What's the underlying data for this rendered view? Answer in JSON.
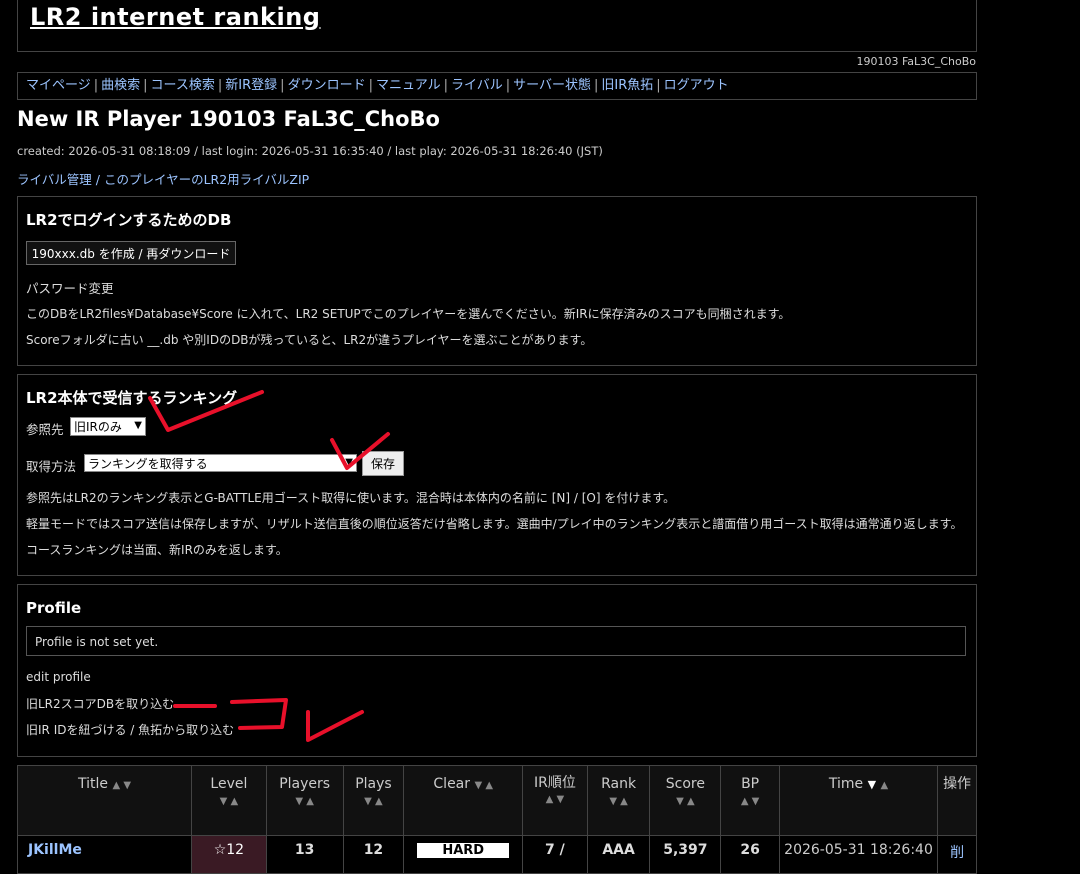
{
  "header": {
    "title": "LR2 internet ranking",
    "user": "190103 FaL3C_ChoBo"
  },
  "nav": {
    "items": [
      "マイページ",
      "曲検索",
      "コース検索",
      "新IR登録",
      "ダウンロード",
      "マニュアル",
      "ライバル",
      "サーバー状態",
      "旧IR魚拓",
      "ログアウト"
    ]
  },
  "player": {
    "title": "New IR Player 190103 FaL3C_ChoBo",
    "meta": "created: 2026-05-31 08:18:09 / last login: 2026-05-31 16:35:40 / last play: 2026-05-31 18:26:40 (JST)",
    "rival_manage": "ライバル管理",
    "rival_sep": " / ",
    "rival_zip": "このプレイヤーのLR2用ライバルZIP"
  },
  "db_box": {
    "title": "LR2でログインするためのDB",
    "button": "190xxx.db を作成 / 再ダウンロード",
    "password_link": "パスワード変更",
    "text1": "このDBをLR2files¥Database¥Score に入れて、LR2 SETUPでこのプレイヤーを選んでください。新IRに保存済みのスコアも同梱されます。",
    "text2": "Scoreフォルダに古い __.db や別IDのDBが残っていると、LR2が違うプレイヤーを選ぶことがあります。"
  },
  "ranking_box": {
    "title": "LR2本体で受信するランキング",
    "ref_label": "参照先",
    "ref_value": "旧IRのみ",
    "method_label": "取得方法",
    "method_value": "ランキングを取得する",
    "save_button": "保存",
    "text1": "参照先はLR2のランキング表示とG-BATTLE用ゴースト取得に使います。混合時は本体内の名前に [N] / [O] を付けます。",
    "text2": "軽量モードではスコア送信は保存しますが、リザルト送信直後の順位返答だけ省略します。選曲中/プレイ中のランキング表示と譜面借り用ゴースト取得は通常通り返します。",
    "text3": "コースランキングは当面、新IRのみを返します。"
  },
  "profile_box": {
    "title": "Profile",
    "placeholder": "Profile is not set yet.",
    "edit_link": "edit profile",
    "import_link": "旧LR2スコアDBを取り込む",
    "link_ir": "旧IR IDを紐づける / 魚拓から取り込む"
  },
  "table": {
    "headers": {
      "title": "Title",
      "level": "Level",
      "players": "Players",
      "plays": "Plays",
      "clear": "Clear",
      "ir_rank": "IR順位",
      "rank": "Rank",
      "score": "Score",
      "bp": "BP",
      "time": "Time",
      "ops": "操作"
    },
    "row": {
      "title": "JKillMe",
      "level": "☆12",
      "players": "13",
      "plays": "12",
      "clear": "HARD",
      "ir_rank": "7 /",
      "rank": "AAA",
      "score": "5,397",
      "bp": "26",
      "time": "2026-05-31 18:26:40",
      "ops": "削"
    }
  },
  "colors": {
    "accent_link": "#9cc4ff",
    "annotation": "#e8102a"
  }
}
